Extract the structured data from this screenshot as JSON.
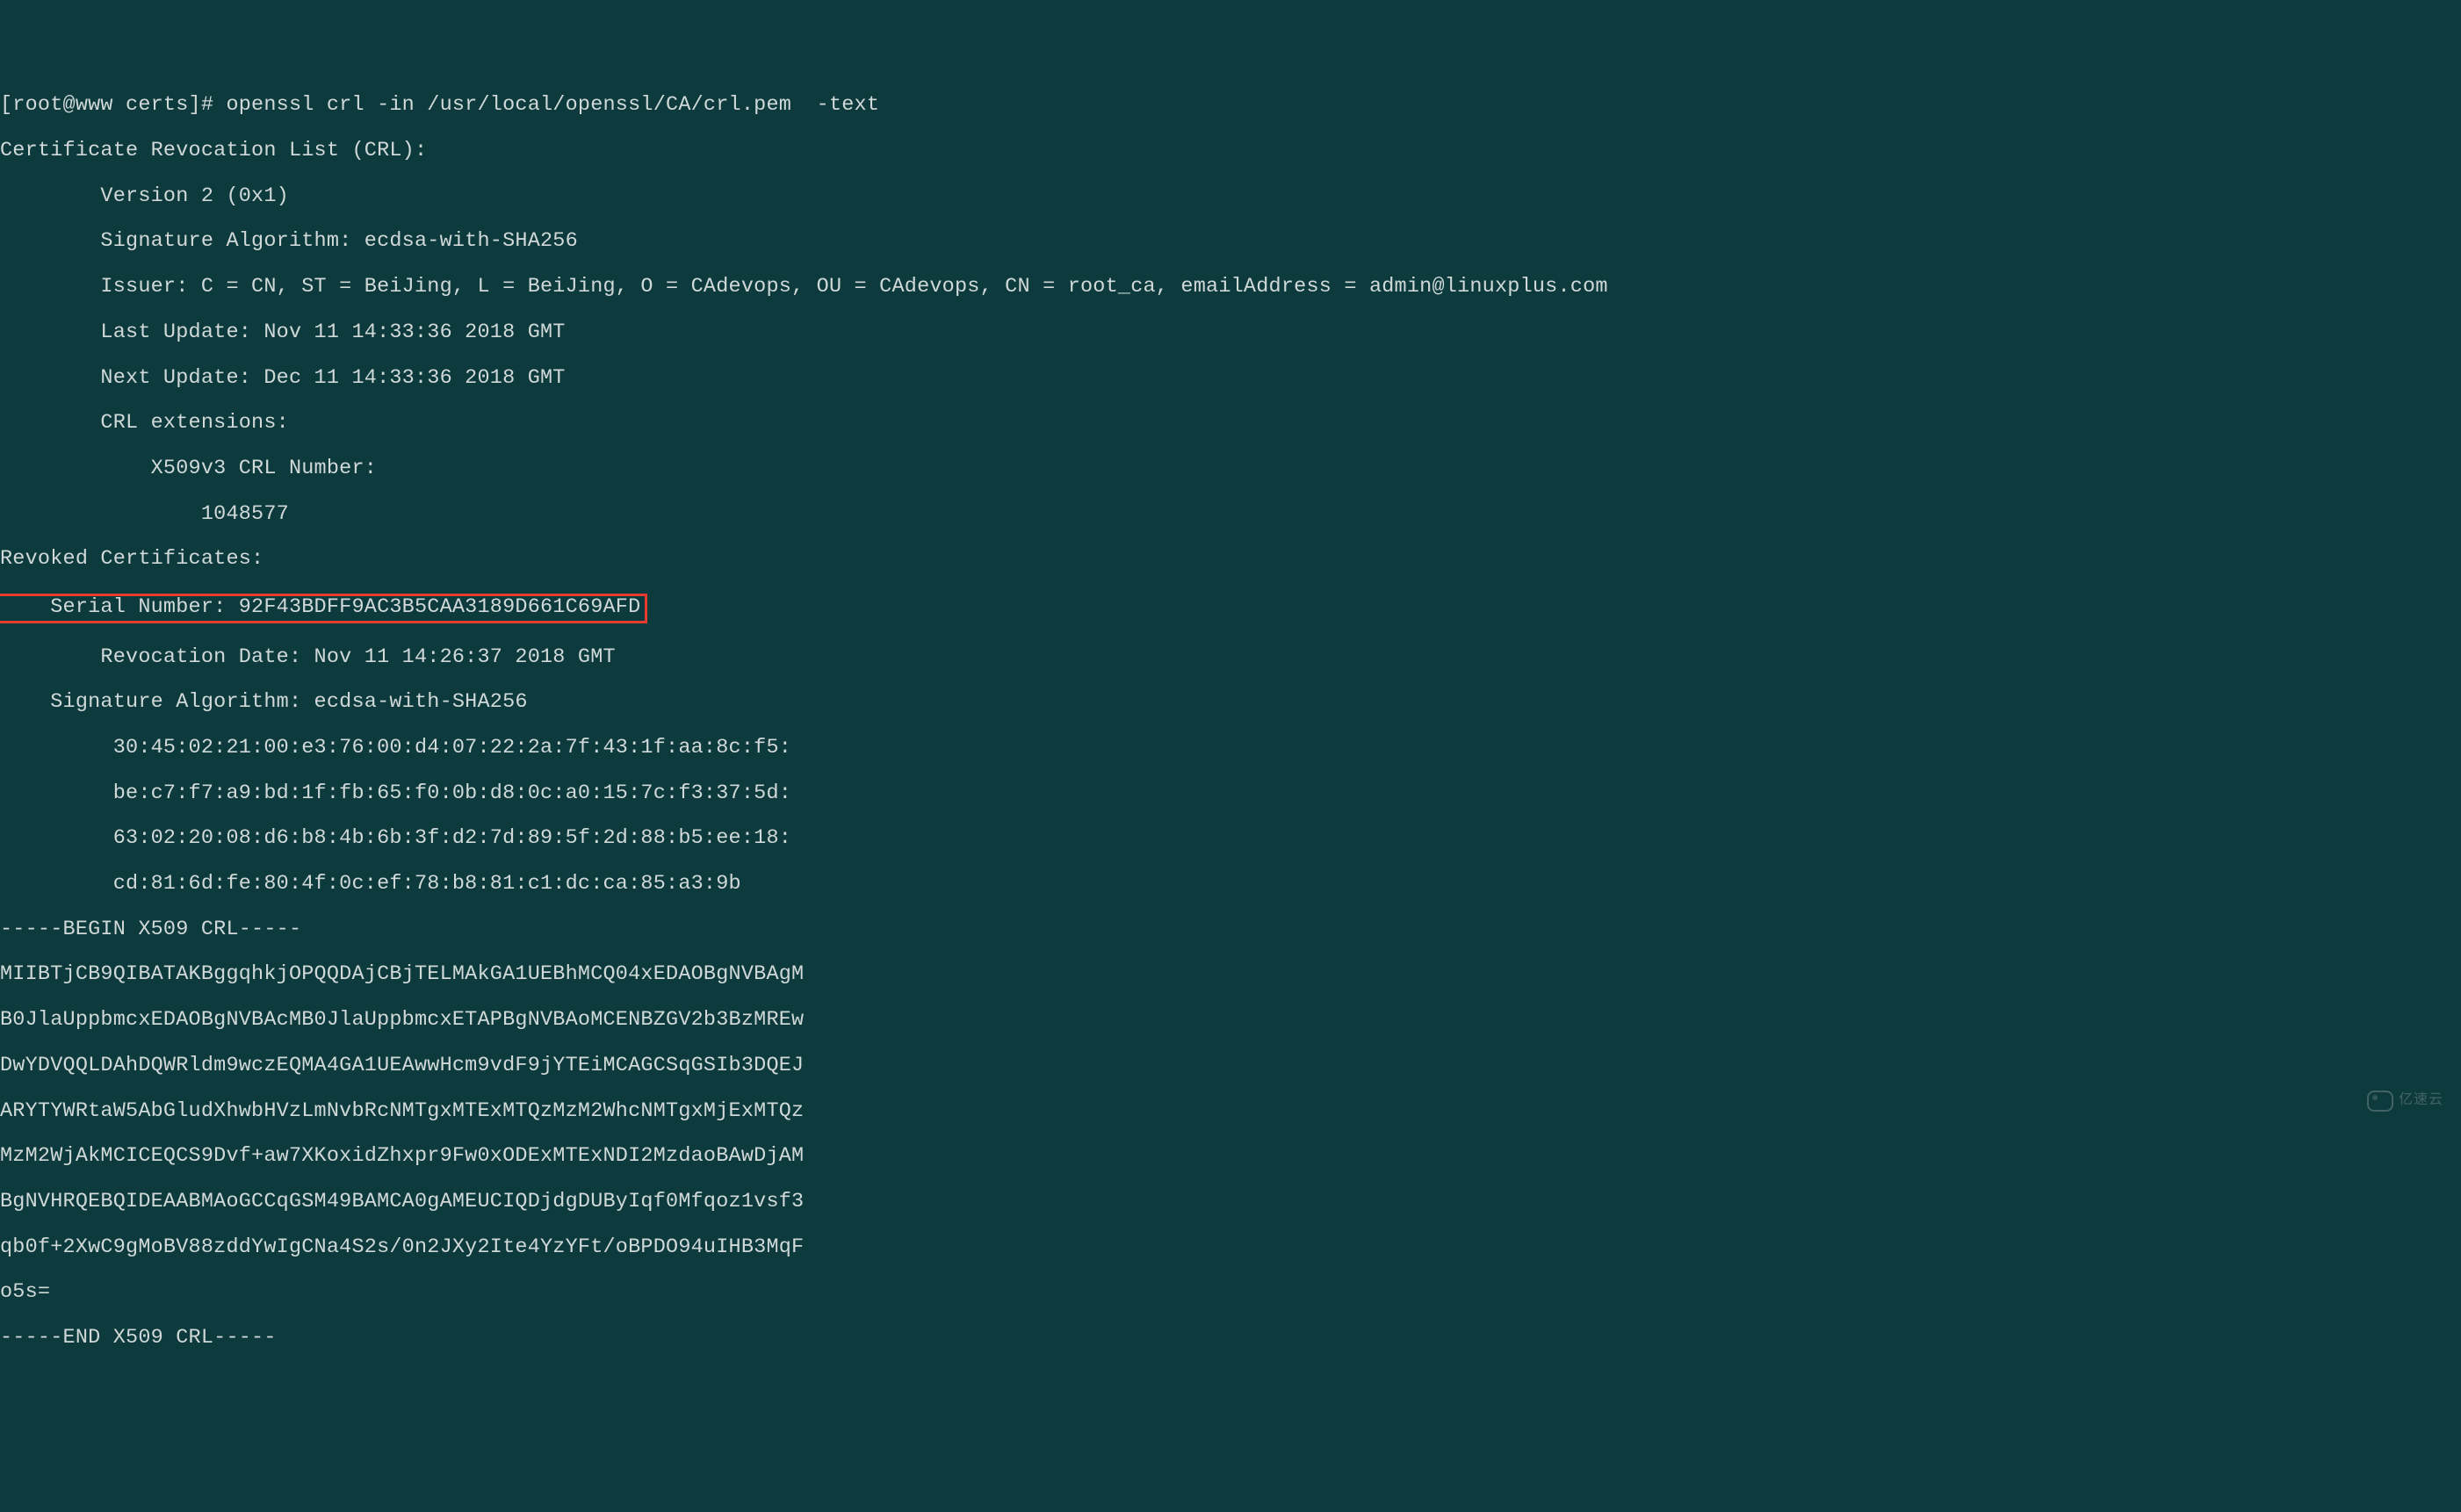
{
  "lines": {
    "prompt": "[root@www certs]# openssl crl -in /usr/local/openssl/CA/crl.pem  -text",
    "header": "Certificate Revocation List (CRL):",
    "version": "        Version 2 (0x1)",
    "sigAlg1": "        Signature Algorithm: ecdsa-with-SHA256",
    "issuer": "        Issuer: C = CN, ST = BeiJing, L = BeiJing, O = CAdevops, OU = CAdevops, CN = root_ca, emailAddress = admin@linuxplus.com",
    "lastUpdate": "        Last Update: Nov 11 14:33:36 2018 GMT",
    "nextUpdate": "        Next Update: Dec 11 14:33:36 2018 GMT",
    "crlExt": "        CRL extensions:",
    "x509num": "            X509v3 CRL Number: ",
    "crlnum": "                1048577",
    "revoked": "Revoked Certificates:",
    "serial": "    Serial Number: 92F43BDFF9AC3B5CAA3189D661C69AFD",
    "revDate": "        Revocation Date: Nov 11 14:26:37 2018 GMT",
    "sigAlg2": "    Signature Algorithm: ecdsa-with-SHA256",
    "sig1": "         30:45:02:21:00:e3:76:00:d4:07:22:2a:7f:43:1f:aa:8c:f5:",
    "sig2": "         be:c7:f7:a9:bd:1f:fb:65:f0:0b:d8:0c:a0:15:7c:f3:37:5d:",
    "sig3": "         63:02:20:08:d6:b8:4b:6b:3f:d2:7d:89:5f:2d:88:b5:ee:18:",
    "sig4": "         cd:81:6d:fe:80:4f:0c:ef:78:b8:81:c1:dc:ca:85:a3:9b",
    "begin": "-----BEGIN X509 CRL-----",
    "b64_1": "MIIBTjCB9QIBATAKBggqhkjOPQQDAjCBjTELMAkGA1UEBhMCQ04xEDAOBgNVBAgM",
    "b64_2": "B0JlaUppbmcxEDAOBgNVBAcMB0JlaUppbmcxETAPBgNVBAoMCENBZGV2b3BzMREw",
    "b64_3": "DwYDVQQLDAhDQWRldm9wczEQMA4GA1UEAwwHcm9vdF9jYTEiMCAGCSqGSIb3DQEJ",
    "b64_4": "ARYTYWRtaW5AbGludXhwbHVzLmNvbRcNMTgxMTExMTQzMzM2WhcNMTgxMjExMTQz",
    "b64_5": "MzM2WjAkMCICEQCS9Dvf+aw7XKoxidZhxpr9Fw0xODExMTExNDI2MzdaoBAwDjAM",
    "b64_6": "BgNVHRQEBQIDEAABMAoGCCqGSM49BAMCA0gAMEUCIQDjdgDUByIqf0Mfqoz1vsf3",
    "b64_7": "qb0f+2XwC9gMoBV88zddYwIgCNa4S2s/0n2JXy2Ite4YzYFt/oBPDO94uIHB3MqF",
    "b64_8": "o5s=",
    "end": "-----END X509 CRL-----"
  },
  "watermark": "亿速云"
}
